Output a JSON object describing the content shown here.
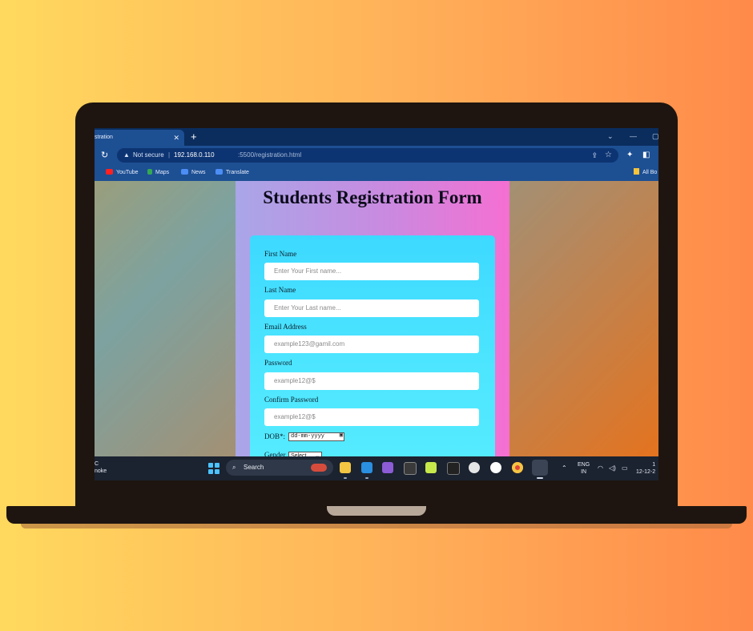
{
  "browser": {
    "tab_title": "stration",
    "new_tab_symbol": "+",
    "security_label": "Not secure",
    "separator": "|",
    "url_host": "192.168.0.110",
    "url_path": ":5500/registration.html",
    "bookmarks": [
      "YouTube",
      "Maps",
      "News",
      "Translate"
    ],
    "all_bookmarks": "All Bo"
  },
  "page": {
    "title": "Students Registration Form",
    "fields": [
      {
        "label": "First Name",
        "placeholder": "Enter Your First name..."
      },
      {
        "label": "Last Name",
        "placeholder": "Enter Your Last name..."
      },
      {
        "label": "Email Address",
        "placeholder": "example123@gamil.com"
      },
      {
        "label": "Password",
        "placeholder": "example12@$"
      },
      {
        "label": "Confirm Password",
        "placeholder": "example12@$"
      }
    ],
    "dob_label": "DOB*:",
    "dob_value": "dd-mm-yyyy",
    "gender_label": "Gender",
    "gender_selected": "Select"
  },
  "taskbar": {
    "left_line1": "C",
    "left_line2": "noke",
    "search_label": "Search",
    "lang_line1": "ENG",
    "lang_line2": "IN",
    "time": "1",
    "date": "12-12-2",
    "app_icons": [
      "file-explorer",
      "vscode",
      "visual-studio",
      "terminal",
      "pycharm",
      "unity",
      "app",
      "node",
      "chrome",
      "chrome-active"
    ]
  },
  "colors": {
    "form_card": "#4ee6ff",
    "column_gradient_end": "#f56fd2",
    "tab_bar": "#0a2d5e"
  }
}
